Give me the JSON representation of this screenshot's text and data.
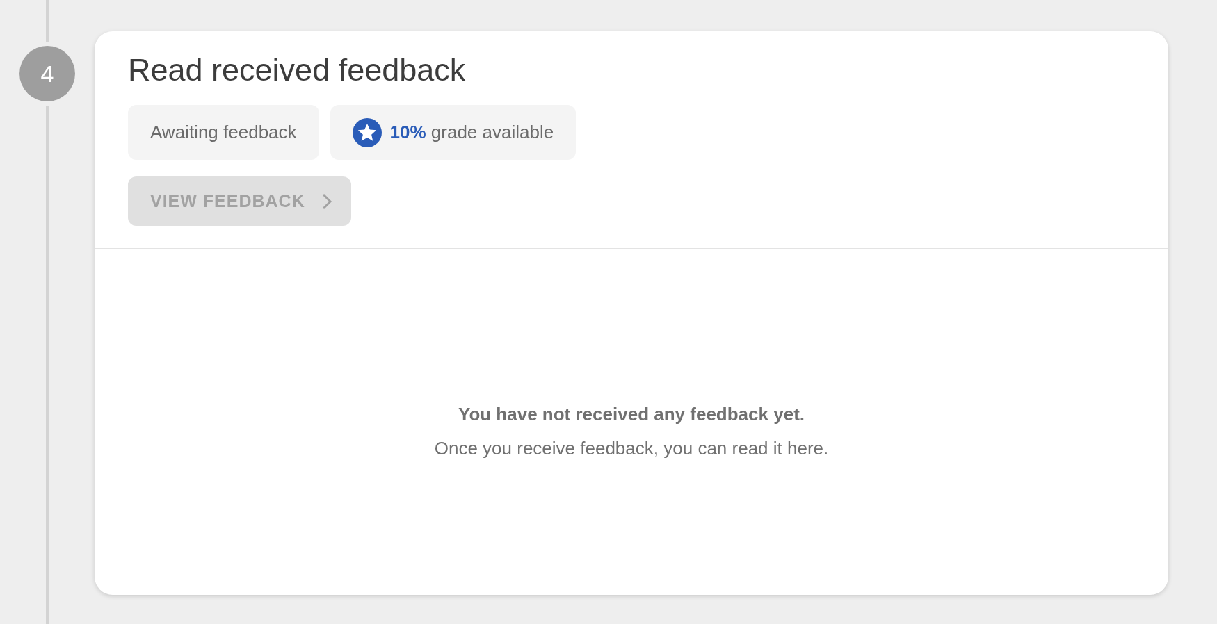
{
  "step": {
    "number": "4",
    "title": "Read received feedback"
  },
  "chips": [
    {
      "kind": "status",
      "text": "Awaiting feedback"
    },
    {
      "kind": "grade",
      "text": "**10%** grade available"
    }
  ],
  "button": {
    "label": "VIEW FEEDBACK",
    "disabled": true
  },
  "empty_state": {
    "heading": "You have not received any feedback yet.",
    "message": "Once you receive feedback, you can read it here."
  }
}
